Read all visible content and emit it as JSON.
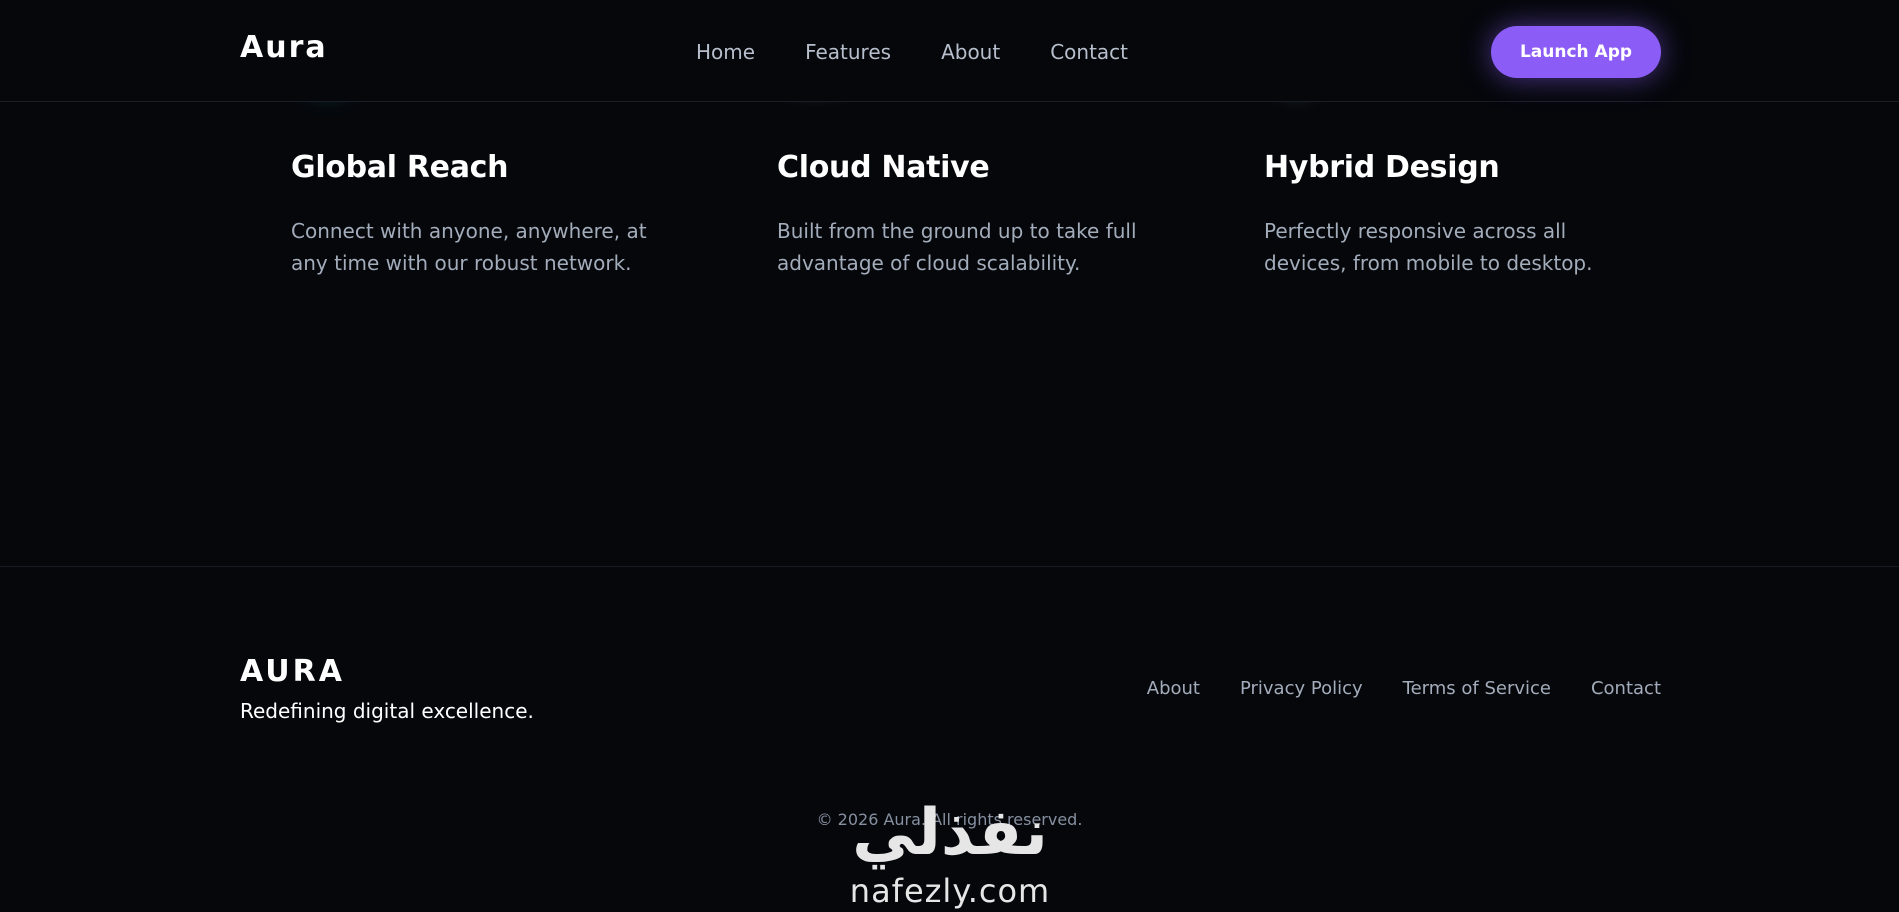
{
  "nav": {
    "logo": "Aura",
    "links": [
      "Home",
      "Features",
      "About",
      "Contact"
    ],
    "cta_label": "Launch App"
  },
  "features": [
    {
      "title": "Global Reach",
      "description": "Connect with anyone, anywhere, at any time with our robust network."
    },
    {
      "title": "Cloud Native",
      "description": "Built from the ground up to take full advantage of cloud scalability."
    },
    {
      "title": "Hybrid Design",
      "description": "Perfectly responsive across all devices, from mobile to desktop."
    }
  ],
  "footer": {
    "logo": "AURA",
    "tagline": "Redefining digital excellence.",
    "links": [
      "About",
      "Privacy Policy",
      "Terms of Service",
      "Contact"
    ],
    "copyright": "© 2026 Aura. All rights reserved."
  },
  "watermark": {
    "arabic": "نفذلي",
    "latin": "nafezly.com"
  },
  "colors": {
    "background": "#05070b",
    "accent": "#8b5cf6",
    "muted_text": "#a3acba"
  }
}
